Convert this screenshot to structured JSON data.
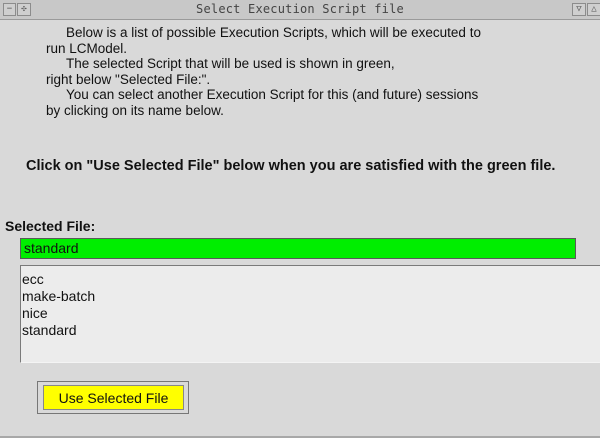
{
  "window": {
    "title": "Select Execution Script file"
  },
  "titlebar": {
    "left_icons": [
      "minus-icon",
      "move-icon"
    ],
    "right_icons": [
      "shade-icon",
      "maximize-icon"
    ]
  },
  "instructions": {
    "lines": [
      "Below is a list of possible Execution Scripts, which will be executed to",
      "run LCModel.",
      "The selected Script that will be used is shown in green,",
      "right below \"Selected File:\".",
      "You can select another Execution Script for this (and future) sessions",
      "by clicking on its name below."
    ],
    "bold": "Click on \"Use Selected File\" below when you are satisfied with the green file."
  },
  "selected": {
    "label": "Selected File:",
    "value": "standard",
    "color": "#00ee00"
  },
  "file_list": {
    "items": [
      "ecc",
      "make-batch",
      "nice",
      "standard"
    ]
  },
  "button": {
    "label": "Use Selected File",
    "color": "#ffff00"
  }
}
